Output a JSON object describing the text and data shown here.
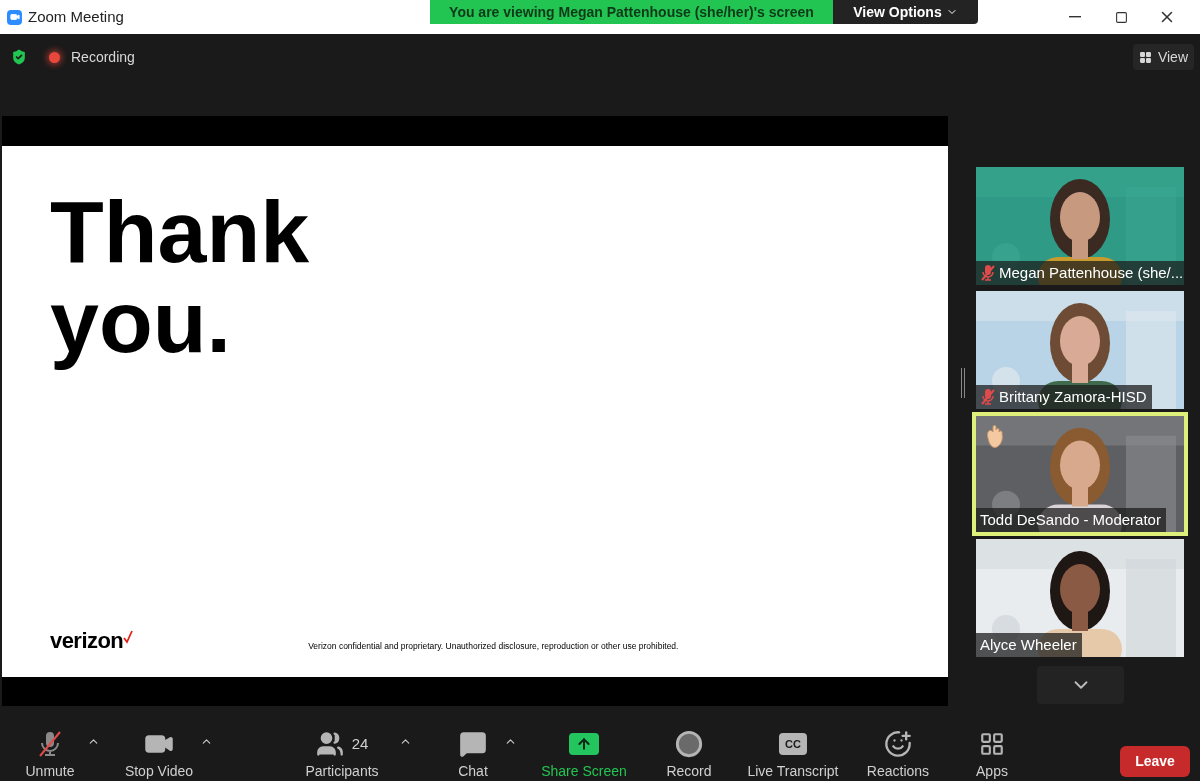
{
  "window": {
    "title": "Zoom Meeting"
  },
  "share_banner": {
    "text": "You are viewing Megan Pattenhouse (she/her)'s screen",
    "button": "View Options"
  },
  "top_bar": {
    "recording": {
      "label": "Recording"
    },
    "view_button": "View"
  },
  "slide": {
    "heading_lines": [
      "Thank",
      "you."
    ],
    "logo": "verizon",
    "footer": "Verizon confidential and proprietary. Unauthorized disclosure, reproduction or other use prohibited."
  },
  "participants": [
    {
      "name": "Megan Pattenhouse (she/...",
      "muted": true,
      "active_speaker": false,
      "hand_raised": false,
      "kind": "picture"
    },
    {
      "name": "Brittany Zamora-HISD",
      "muted": true,
      "active_speaker": false,
      "hand_raised": false,
      "kind": "picture"
    },
    {
      "name": "Todd DeSando - Moderator",
      "muted": false,
      "active_speaker": true,
      "hand_raised": true,
      "kind": "picture"
    },
    {
      "name": "Alyce Wheeler",
      "muted": false,
      "active_speaker": false,
      "hand_raised": false,
      "kind": "picture"
    }
  ],
  "toolbar": [
    {
      "kind": "mic",
      "label": "Unmute",
      "has_menu": true
    },
    {
      "kind": "video",
      "label": "Stop Video",
      "has_menu": true
    },
    {
      "kind": "participants",
      "label": "Participants",
      "count": "24",
      "has_menu": true
    },
    {
      "kind": "chat",
      "label": "Chat",
      "has_menu": true
    },
    {
      "kind": "share",
      "label": "Share Screen",
      "has_menu": false
    },
    {
      "kind": "record",
      "label": "Record",
      "has_menu": false
    },
    {
      "kind": "transcript",
      "label": "Live Transcript",
      "badge": "CC",
      "has_menu": false
    },
    {
      "kind": "reactions",
      "label": "Reactions",
      "has_menu": false
    },
    {
      "kind": "apps",
      "label": "Apps",
      "has_menu": false
    }
  ],
  "leave_button": "Leave"
}
